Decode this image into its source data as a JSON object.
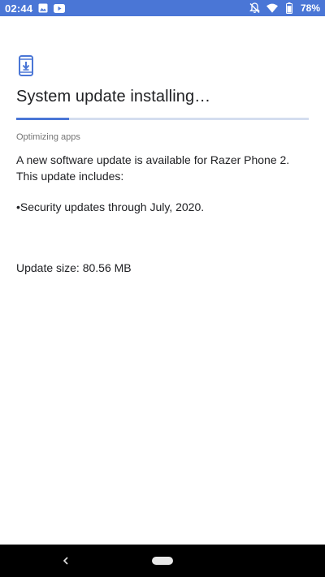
{
  "status_bar": {
    "time": "02:44",
    "battery": "78%",
    "background_color": "#4a76d6",
    "left_icons": [
      "image-icon",
      "youtube-icon"
    ],
    "right_icons": [
      "notifications-off-icon",
      "wifi-icon",
      "battery-icon"
    ]
  },
  "page": {
    "icon": "system-update-icon",
    "title": "System update installing…",
    "progress_fraction": 0.18,
    "status": "Optimizing apps",
    "description": "A new software update is available for Razer Phone 2. This update includes:",
    "bullet": "•Security updates through July, 2020.",
    "update_size": "Update size: 80.56 MB"
  },
  "nav_bar": {
    "back_icon": "back-icon",
    "home_icon": "home-pill-icon"
  },
  "colors": {
    "accent": "#4a76d6",
    "progress_track": "#d4ddef",
    "text_primary": "#202124",
    "text_secondary": "#757575"
  }
}
